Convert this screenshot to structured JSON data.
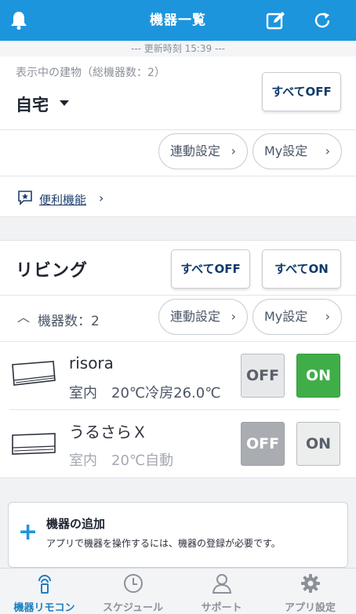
{
  "header": {
    "title": "機器一覧",
    "left_icon": "bell-icon",
    "edit_icon": "edit-icon",
    "refresh_icon": "refresh-icon"
  },
  "updated": "--- 更新時刻 15:39 ---",
  "building": {
    "caption": "表示中の建物（総機器数：2）",
    "name": "自宅",
    "all_off_label": "すべてOFF",
    "link_setting_label": "連動設定",
    "my_setting_label": "My設定",
    "utility_label": "便利機能"
  },
  "room": {
    "name": "リビング",
    "all_off_label": "すべてOFF",
    "all_on_label": "すべてON",
    "device_count_label": "機器数：2",
    "link_setting_label": "連動設定",
    "my_setting_label": "My設定"
  },
  "devices": [
    {
      "name": "risora",
      "status": "室内　20℃冷房26.0℃",
      "off_label": "OFF",
      "on_label": "ON",
      "power": "on"
    },
    {
      "name": "うるさらＸ",
      "status": "室内　20℃自動",
      "off_label": "OFF",
      "on_label": "ON",
      "power": "off"
    }
  ],
  "add_device": {
    "title": "機器の追加",
    "description": "アプリで機器を操作するには、機器の登録が必要です。"
  },
  "tabs": [
    {
      "label": "機器リモコン",
      "icon": "remote-icon",
      "active": true
    },
    {
      "label": "スケジュール",
      "icon": "clock-icon",
      "active": false
    },
    {
      "label": "サポート",
      "icon": "person-icon",
      "active": false
    },
    {
      "label": "アプリ設定",
      "icon": "gear-icon",
      "active": false
    }
  ],
  "colors": {
    "header_blue": "#1c95dd",
    "on_green": "#3fae49",
    "off_gray": "#a9acb1",
    "navy_text": "#0f3a6b"
  }
}
